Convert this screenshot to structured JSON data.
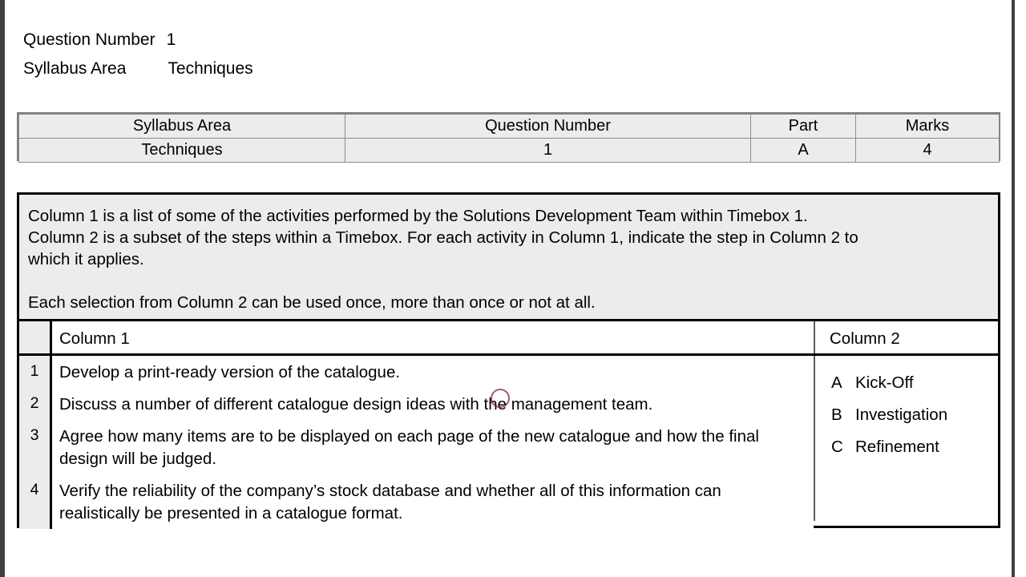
{
  "header": {
    "question_number_label": "Question Number",
    "question_number_value": "1",
    "syllabus_area_label": "Syllabus Area",
    "syllabus_area_value": "Techniques"
  },
  "info_table": {
    "headers": [
      "Syllabus Area",
      "Question Number",
      "Part",
      "Marks"
    ],
    "values": [
      "Techniques",
      "1",
      "A",
      "4"
    ]
  },
  "instructions": {
    "line1": "Column 1 is a list of some of the activities performed by the Solutions Development Team within Timebox 1.",
    "line2": "Column 2 is a subset of the steps within a Timebox. For each activity in Column 1, indicate the step in Column 2 to",
    "line3": "which it applies.",
    "line4": "Each selection from Column 2 can be used once, more than once or not at all."
  },
  "columns": {
    "column1_header": "Column 1",
    "column2_header": "Column 2"
  },
  "activities": [
    {
      "num": "1",
      "text": "Develop a print-ready version of the catalogue."
    },
    {
      "num": "2",
      "text": "Discuss a number of different catalogue design ideas with the management team."
    },
    {
      "num": "3",
      "text": "Agree how many items are to be displayed on each page of the new catalogue and how the final design will be judged."
    },
    {
      "num": "4",
      "text": "Verify the reliability of the company’s stock database and whether all of this information can realistically be presented in a catalogue format."
    }
  ],
  "options": [
    {
      "letter": "A",
      "label": "Kick-Off"
    },
    {
      "letter": "B",
      "label": "Investigation"
    },
    {
      "letter": "C",
      "label": "Refinement"
    }
  ],
  "colors": {
    "panel_border": "#000000",
    "table_fill": "#ececec",
    "click_marker": "#8d1d3e",
    "frame_rail": "#3b4044",
    "scrollbar_thumb": "#c9c9c9"
  }
}
